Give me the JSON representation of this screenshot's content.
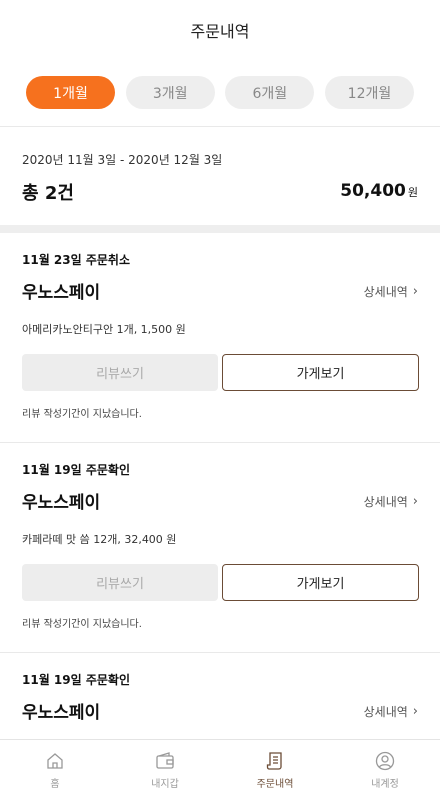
{
  "header": {
    "title": "주문내역"
  },
  "period_tabs": [
    {
      "label": "1개월",
      "active": true
    },
    {
      "label": "3개월",
      "active": false
    },
    {
      "label": "6개월",
      "active": false
    },
    {
      "label": "12개월",
      "active": false
    }
  ],
  "summary": {
    "period": "2020년 11월 3일 - 2020년 12월 3일",
    "total_count": "총 2건",
    "total_amount": "50,400",
    "currency": "원"
  },
  "orders": [
    {
      "status": "11월 23일 주문취소",
      "store": "우노스페이",
      "detail_label": "상세내역",
      "items": "아메리카노안티구안 1개, 1,500 원",
      "review_label": "리뷰쓰기",
      "store_button_label": "가게보기",
      "review_note": "리뷰 작성기간이 지났습니다."
    },
    {
      "status": "11월 19일 주문확인",
      "store": "우노스페이",
      "detail_label": "상세내역",
      "items": "카페라떼 맛 씀 12개, 32,400 원",
      "review_label": "리뷰쓰기",
      "store_button_label": "가게보기",
      "review_note": "리뷰 작성기간이 지났습니다."
    },
    {
      "status": "11월 19일 주문확인",
      "store": "우노스페이",
      "detail_label": "상세내역"
    }
  ],
  "bottom_nav": [
    {
      "label": "홈",
      "icon": "home-icon",
      "active": false
    },
    {
      "label": "내지갑",
      "icon": "wallet-icon",
      "active": false
    },
    {
      "label": "주문내역",
      "icon": "receipt-icon",
      "active": true
    },
    {
      "label": "내계정",
      "icon": "user-icon",
      "active": false
    }
  ],
  "colors": {
    "accent": "#f6711e",
    "brown": "#6b4c36",
    "muted": "#eeeeee"
  }
}
